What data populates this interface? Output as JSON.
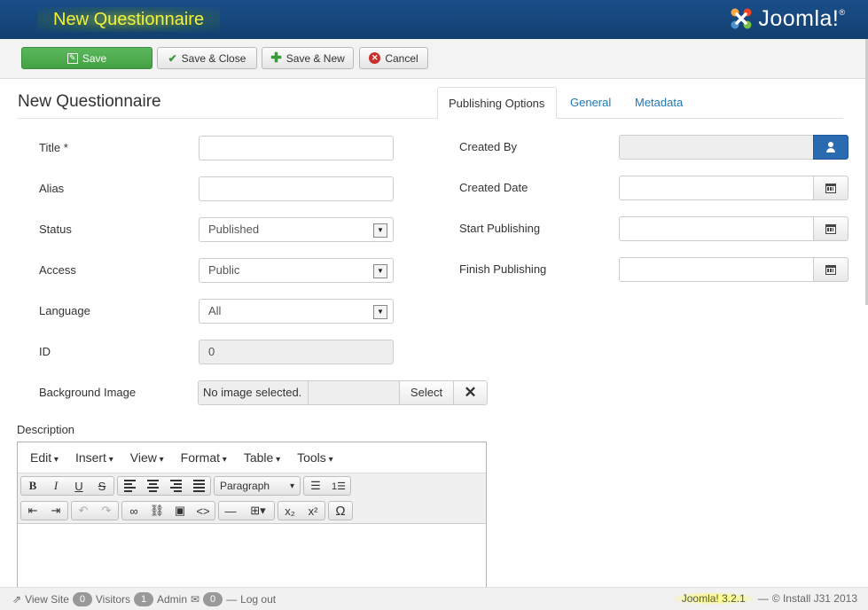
{
  "header": {
    "page_title": "New Questionnaire",
    "logo_text": "Joomla!",
    "logo_mark": "®",
    "background_color": "#12406f",
    "title_color": "#f2f23c"
  },
  "toolbar": {
    "save_label": "Save",
    "save_close_label": "Save & Close",
    "save_new_label": "Save & New",
    "cancel_label": "Cancel",
    "save_color": "#4cae4c"
  },
  "form": {
    "heading": "New Questionnaire",
    "fields": {
      "title": {
        "label": "Title *",
        "value": ""
      },
      "alias": {
        "label": "Alias",
        "value": ""
      },
      "status": {
        "label": "Status",
        "value": "Published"
      },
      "access": {
        "label": "Access",
        "value": "Public"
      },
      "language": {
        "label": "Language",
        "value": "All"
      },
      "id": {
        "label": "ID",
        "value": "0"
      },
      "background_image": {
        "label": "Background Image",
        "value": "No image selected.",
        "select_label": "Select",
        "clear_icon": "close-icon"
      }
    },
    "description_label": "Description"
  },
  "tabs": {
    "publishing": "Publishing Options",
    "general": "General",
    "metadata": "Metadata",
    "active": "Publishing Options"
  },
  "publishing": {
    "created_by": {
      "label": "Created By",
      "value": ""
    },
    "created_date": {
      "label": "Created Date",
      "value": ""
    },
    "start_publishing": {
      "label": "Start Publishing",
      "value": ""
    },
    "finish_publishing": {
      "label": "Finish Publishing",
      "value": ""
    }
  },
  "editor": {
    "menus": [
      "Edit",
      "Insert",
      "View",
      "Format",
      "Table",
      "Tools"
    ],
    "format_select": "Paragraph",
    "buttons_row1": [
      "bold",
      "italic",
      "underline",
      "strikethrough",
      "align-left",
      "align-center",
      "align-right",
      "justify",
      "bullet-list",
      "numbered-list"
    ],
    "buttons_row2": [
      "outdent",
      "indent",
      "undo",
      "redo",
      "link",
      "unlink",
      "image",
      "code",
      "horizontal-rule",
      "table",
      "subscript",
      "superscript",
      "special-character"
    ],
    "glyphs": {
      "bold": "B",
      "italic": "I",
      "underline": "U",
      "strikethrough": "S",
      "undo": "↶",
      "redo": "↷",
      "link": "🔗",
      "unlink": "⛓",
      "image": "▣",
      "code": "<>",
      "hr": "—",
      "table": "⊞▾",
      "subscript": "x₂",
      "superscript": "x²",
      "special": "Ω"
    }
  },
  "statusbar": {
    "view_site": "View Site",
    "visitors_count": "0",
    "visitors_label": "Visitors",
    "admin_count": "1",
    "admin_label": "Admin",
    "mail_count": "0",
    "logout": "Log out",
    "version": "Joomla! 3.2.1",
    "separator": "—",
    "copyright": "© Install J31 2013"
  }
}
